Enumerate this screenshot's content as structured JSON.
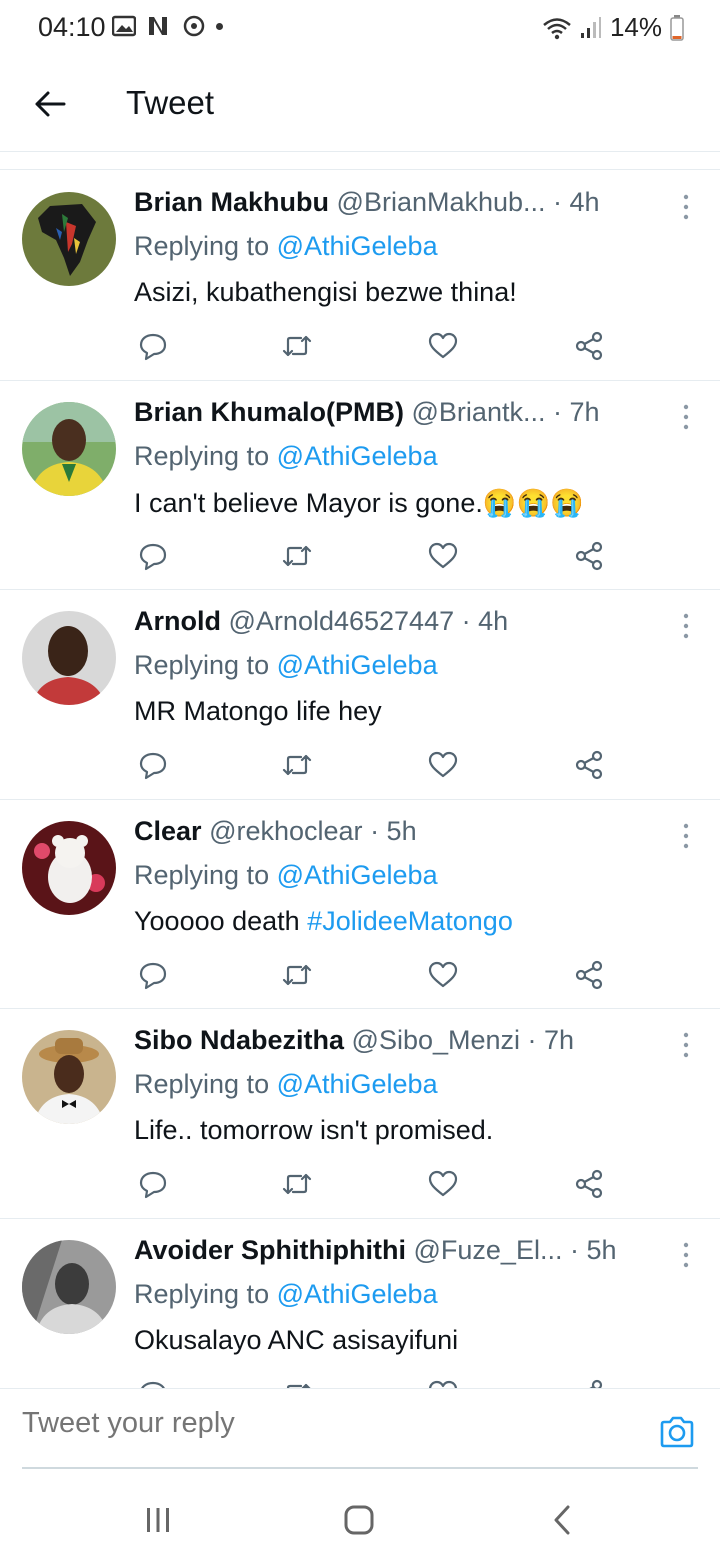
{
  "status_bar": {
    "time": "04:10",
    "battery": "14%",
    "icons": [
      "gallery-icon",
      "netflix-icon",
      "sync-icon",
      "wifi-icon",
      "signal-icon",
      "battery-icon"
    ]
  },
  "header": {
    "title": "Tweet",
    "back_icon": "arrow-left-icon"
  },
  "tweets": [
    {
      "name": "Brian Makhubu",
      "handle": "@BrianMakhub...",
      "time": "· 4h",
      "replying_prefix": "Replying to ",
      "replying_to": "@AthiGeleba",
      "text": "Asizi, kubathengisi bezwe thina!"
    },
    {
      "name": "Brian Khumalo(PMB)",
      "handle": "@Briantk...",
      "time": "· 7h",
      "replying_prefix": "Replying to ",
      "replying_to": "@AthiGeleba",
      "text": "I can't believe Mayor is gone.😭😭😭"
    },
    {
      "name": "Arnold",
      "handle": "@Arnold46527447",
      "time": "· 4h",
      "replying_prefix": "Replying to ",
      "replying_to": "@AthiGeleba",
      "text": "MR Matongo life hey"
    },
    {
      "name": "Clear",
      "handle": "@rekhoclear",
      "time": "· 5h",
      "replying_prefix": "Replying to ",
      "replying_to": "@AthiGeleba",
      "text": "Yooooo death ",
      "hashtag": "#JolideeMatongo"
    },
    {
      "name": "Sibo Ndabezitha",
      "handle": "@Sibo_Menzi",
      "time": "· 7h",
      "replying_prefix": "Replying to ",
      "replying_to": "@AthiGeleba",
      "text": "Life.. tomorrow isn't promised."
    },
    {
      "name": "Avoider Sphithiphithi",
      "handle": "@Fuze_El...",
      "time": "· 5h",
      "replying_prefix": "Replying to ",
      "replying_to": "@AthiGeleba",
      "text": "Okusalayo ANC asisayifuni"
    }
  ],
  "composer": {
    "placeholder": "Tweet your reply",
    "camera_icon": "camera-icon"
  },
  "nav_bar": {
    "buttons": [
      "recents-icon",
      "home-icon",
      "back-icon"
    ]
  },
  "colors": {
    "accent": "#1d9bf0",
    "text_primary": "#0f1419",
    "text_secondary": "#536471",
    "divider": "#e6ecf0"
  }
}
